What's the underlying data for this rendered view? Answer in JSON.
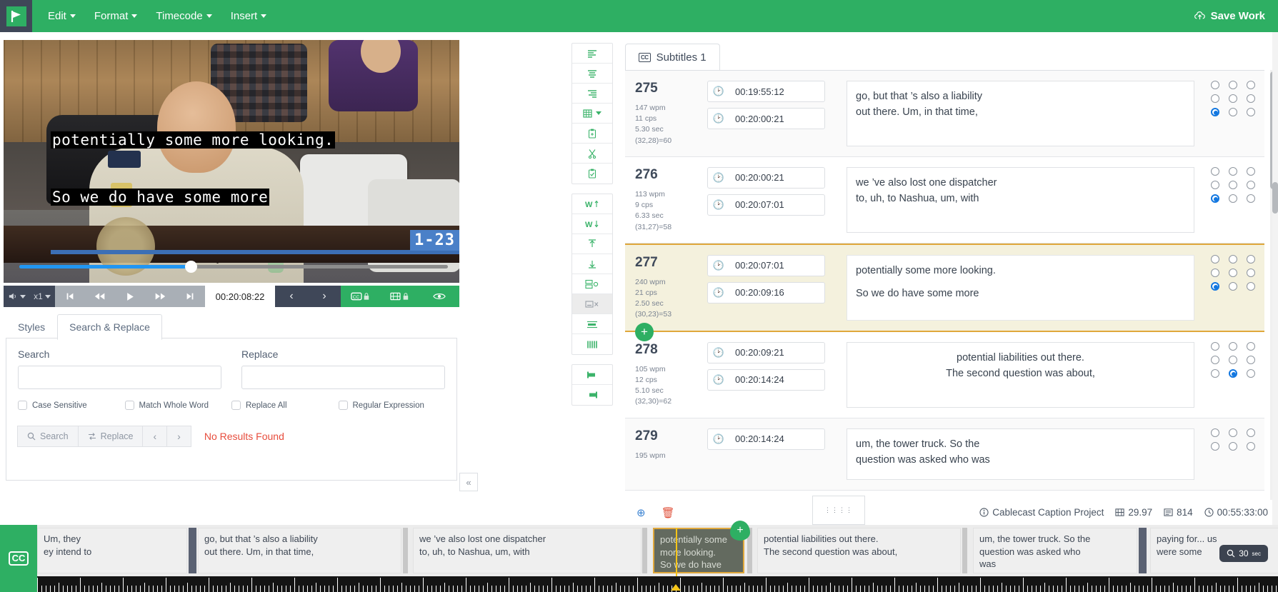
{
  "header": {
    "logo_icon": "play-flag-logo",
    "menus": [
      {
        "label": "Edit"
      },
      {
        "label": "Format"
      },
      {
        "label": "Timecode"
      },
      {
        "label": "Insert"
      }
    ],
    "save_label": "Save Work",
    "save_icon": "cloud-upload-icon",
    "brand_color": "#2eaf63"
  },
  "player": {
    "caption_line1": "potentially some more looking.",
    "caption_line2": "So we do have some more",
    "corner_tag": "1-23",
    "timecode": "00:20:08:22",
    "speed": "x1",
    "volume_icon": "volume-icon",
    "buttons": {
      "start": "skip-to-start-icon",
      "rewind": "rewind-icon",
      "play": "play-icon",
      "forward": "fast-forward-icon",
      "end": "skip-to-end-icon",
      "prev": "prev-chevron-icon",
      "next": "next-chevron-icon",
      "cc_lock": "cc-lock-icon",
      "film_lock": "film-lock-icon",
      "eye": "eye-icon"
    }
  },
  "panel": {
    "tabs": [
      {
        "label": "Styles",
        "active": false
      },
      {
        "label": "Search & Replace",
        "active": true
      }
    ],
    "search_label": "Search",
    "replace_label": "Replace",
    "search_value": "",
    "replace_value": "",
    "search_placeholder": "",
    "replace_placeholder": "",
    "checkboxes": [
      {
        "label": "Case Sensitive",
        "checked": false
      },
      {
        "label": "Match Whole Word",
        "checked": false
      },
      {
        "label": "Replace All",
        "checked": false
      },
      {
        "label": "Regular Expression",
        "checked": false
      }
    ],
    "buttons": [
      {
        "label": "Search",
        "icon": "magnifier-icon"
      },
      {
        "label": "Replace",
        "icon": "swap-icon"
      },
      {
        "label": "‹",
        "icon": "prev-icon"
      },
      {
        "label": "›",
        "icon": "next-icon"
      }
    ],
    "status": "No Results Found",
    "status_color": "#e74c3c",
    "collapse_icon": "double-chevron-left-icon"
  },
  "toolbar": {
    "groups": [
      {
        "items": [
          {
            "icon": "align-left-icon"
          },
          {
            "icon": "align-center-icon"
          },
          {
            "icon": "align-right-icon"
          },
          {
            "icon": "table-dropdown-icon"
          },
          {
            "icon": "paste-plus-icon"
          },
          {
            "icon": "scissors-icon"
          },
          {
            "icon": "paste-check-icon"
          }
        ]
      },
      {
        "items": [
          {
            "icon": "word-up-icon"
          },
          {
            "icon": "word-down-icon"
          },
          {
            "icon": "move-up-icon"
          },
          {
            "icon": "move-down-icon"
          },
          {
            "icon": "split-caption-icon"
          },
          {
            "icon": "merge-caption-icon",
            "selected": true
          },
          {
            "icon": "single-line-icon"
          },
          {
            "icon": "columns-icon"
          }
        ]
      },
      {
        "items": [
          {
            "icon": "set-in-point-icon"
          },
          {
            "icon": "set-out-point-icon"
          }
        ]
      }
    ]
  },
  "subtitles": {
    "tab_label": "Subtitles 1",
    "tab_icon": "cc-icon",
    "rows": [
      {
        "number": "275",
        "wpm": "147 wpm",
        "cps": "11 cps",
        "duration": "5.30 sec",
        "chars": "(32,28)=60",
        "start": "00:19:55:12",
        "end": "00:20:00:21",
        "text_line1": "go, but that ’s also a liability",
        "text_line2": "out there. Um, in that time,",
        "align": "left",
        "selected": false,
        "position_row": 2,
        "position_col": 0
      },
      {
        "number": "276",
        "wpm": "113 wpm",
        "cps": "9 cps",
        "duration": "6.33 sec",
        "chars": "(31,27)=58",
        "start": "00:20:00:21",
        "end": "00:20:07:01",
        "text_line1": "we ’ve also lost one dispatcher",
        "text_line2": "to, uh, to Nashua, um, with",
        "align": "left",
        "selected": false,
        "position_row": 2,
        "position_col": 0
      },
      {
        "number": "277",
        "wpm": "240 wpm",
        "cps": "21 cps",
        "duration": "2.50 sec",
        "chars": "(30,23)=53",
        "start": "00:20:07:01",
        "end": "00:20:09:16",
        "text_line1": "potentially some more looking.",
        "text_line2": "So we do have some more",
        "align": "left",
        "selected": true,
        "position_row": 2,
        "position_col": 0
      },
      {
        "number": "278",
        "wpm": "105 wpm",
        "cps": "12 cps",
        "duration": "5.10 sec",
        "chars": "(32,30)=62",
        "start": "00:20:09:21",
        "end": "00:20:14:24",
        "text_line1": "potential liabilities out there.",
        "text_line2": "The second question was about,",
        "align": "center",
        "selected": false,
        "position_row": 2,
        "position_col": 1
      },
      {
        "number": "279",
        "wpm": "195 wpm",
        "cps": "",
        "duration": "",
        "chars": "",
        "start": "00:20:14:24",
        "end": "",
        "text_line1": "um, the tower truck. So the",
        "text_line2": "question was asked who was",
        "align": "left",
        "selected": false,
        "position_row": 0,
        "position_col": 0
      }
    ],
    "add_row_icon": "plus-circle-icon"
  },
  "statusbar": {
    "add_icon": "add-circle-icon",
    "delete_icon": "trash-icon",
    "grip_icon": "grip-dots-icon",
    "project_name": "Cablecast Caption Project",
    "project_icon": "info-icon",
    "framerate": "29.97",
    "framerate_icon": "film-icon",
    "caption_count": "814",
    "caption_count_icon": "list-icon",
    "total_duration": "00:55:33:00",
    "duration_icon": "clock-icon"
  },
  "timeline": {
    "cc_icon": "cc-icon",
    "zoom_label": "30",
    "zoom_unit": "sec",
    "zoom_icon": "magnifier-icon",
    "cues": [
      {
        "line1": "Um, they",
        "line2": "ey intend to",
        "line3": "",
        "active": false
      },
      {
        "line1": "go, but that ’s also a liability",
        "line2": "out there. Um, in that time,",
        "line3": "",
        "active": false
      },
      {
        "line1": "we ’ve also lost one dispatcher",
        "line2": "to, uh, to Nashua, um, with",
        "line3": "",
        "active": false
      },
      {
        "line1": "potentially some",
        "line2": "more looking.",
        "line3": "So we do have",
        "active": true
      },
      {
        "line1": "potential liabilities out there.",
        "line2": "The second question was about,",
        "line3": "",
        "active": false
      },
      {
        "line1": "um, the tower truck. So the",
        "line2": "question was asked who",
        "line3": "was",
        "active": false
      },
      {
        "line1": "paying for... us",
        "line2": "were some",
        "line3": "",
        "active": false
      }
    ]
  }
}
